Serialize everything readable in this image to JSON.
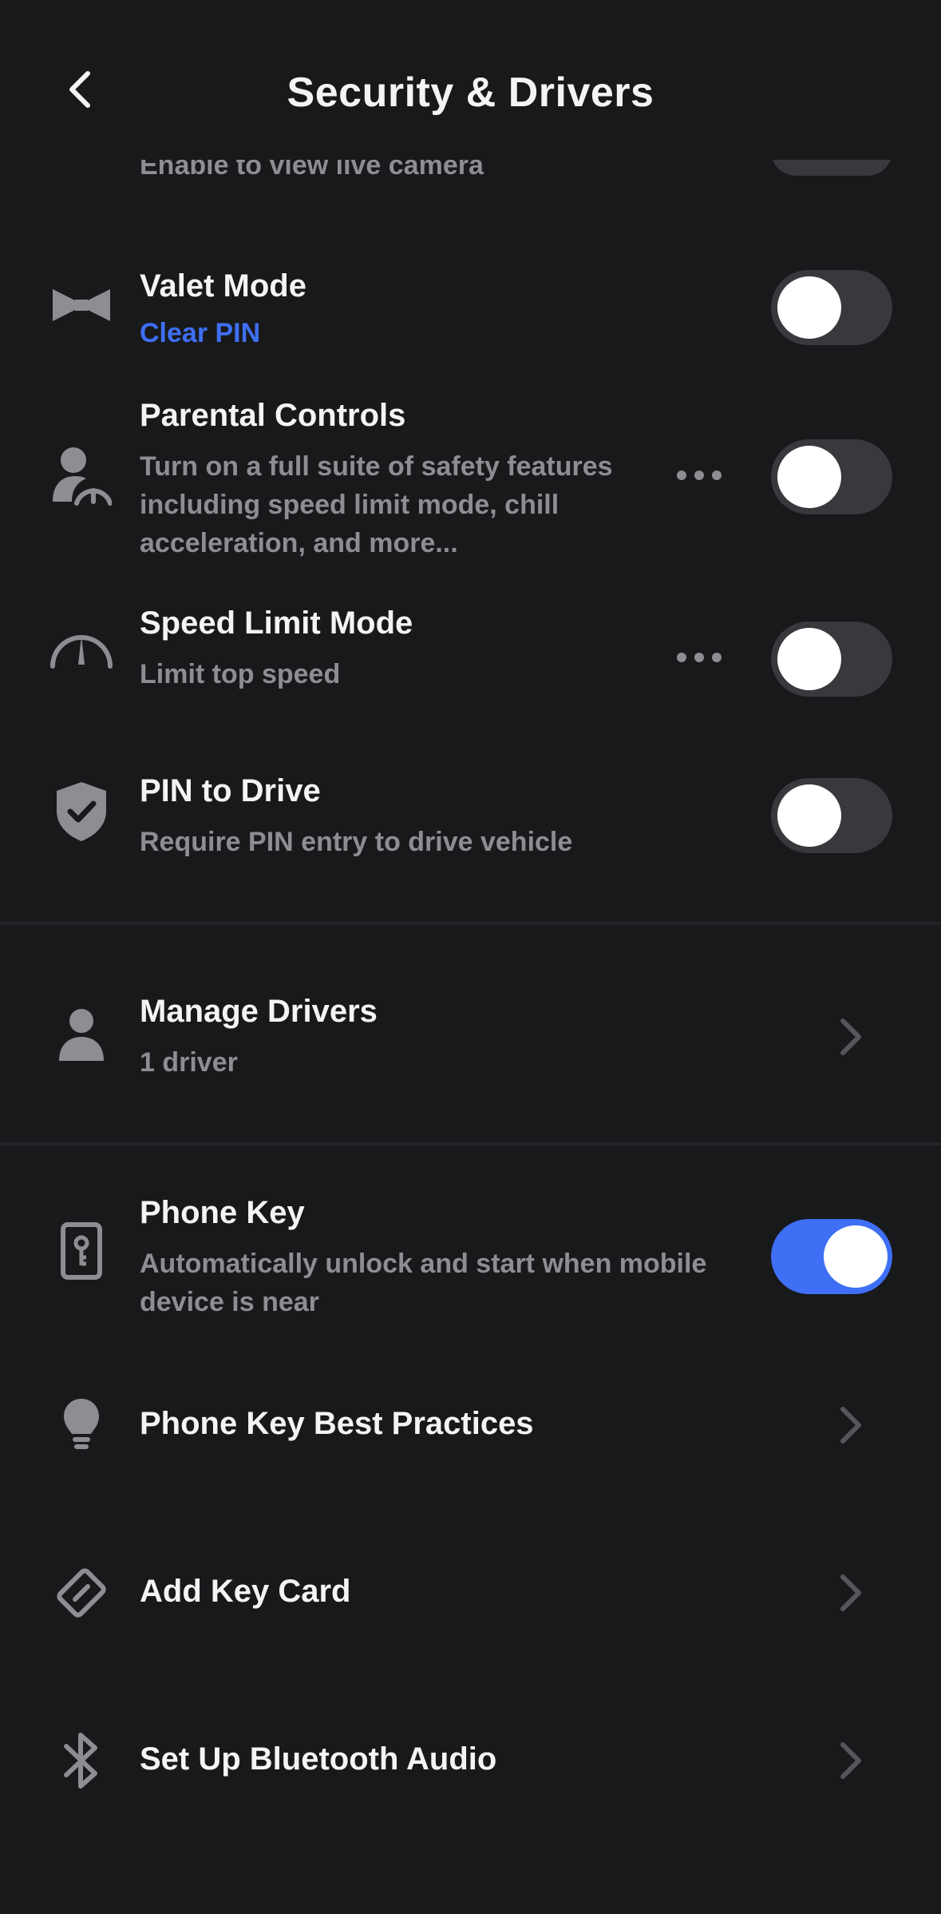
{
  "header": {
    "title": "Security & Drivers",
    "back_icon": "chevron-left-icon"
  },
  "peek_row": {
    "subtitle": "Enable to view live camera"
  },
  "rows": {
    "valet": {
      "title": "Valet Mode",
      "link": "Clear PIN",
      "icon": "bowtie-icon",
      "toggle_on": false
    },
    "parental": {
      "title": "Parental Controls",
      "subtitle": "Turn on a full suite of safety features including speed limit mode, chill acceleration, and more...",
      "icon": "person-gauge-icon",
      "toggle_on": false
    },
    "speed": {
      "title": "Speed Limit Mode",
      "subtitle": "Limit top speed",
      "icon": "speedometer-icon",
      "toggle_on": false
    },
    "pin": {
      "title": "PIN to Drive",
      "subtitle": "Require PIN entry to drive vehicle",
      "icon": "shield-check-icon",
      "toggle_on": false
    },
    "drivers": {
      "title": "Manage Drivers",
      "subtitle": "1 driver",
      "icon": "person-icon"
    },
    "phone_key": {
      "title": "Phone Key",
      "subtitle": "Automatically unlock and start when mobile device is near",
      "icon": "phone-key-icon",
      "toggle_on": true
    },
    "best_practices": {
      "title": "Phone Key Best Practices",
      "icon": "lightbulb-icon"
    },
    "key_card": {
      "title": "Add Key Card",
      "icon": "key-card-icon"
    },
    "bluetooth": {
      "title": "Set Up Bluetooth Audio",
      "icon": "bluetooth-icon"
    }
  },
  "colors": {
    "background": "#18191b",
    "accent": "#3e6ff4",
    "secondary_text": "#8d8e91",
    "toggle_off": "#38393d"
  }
}
